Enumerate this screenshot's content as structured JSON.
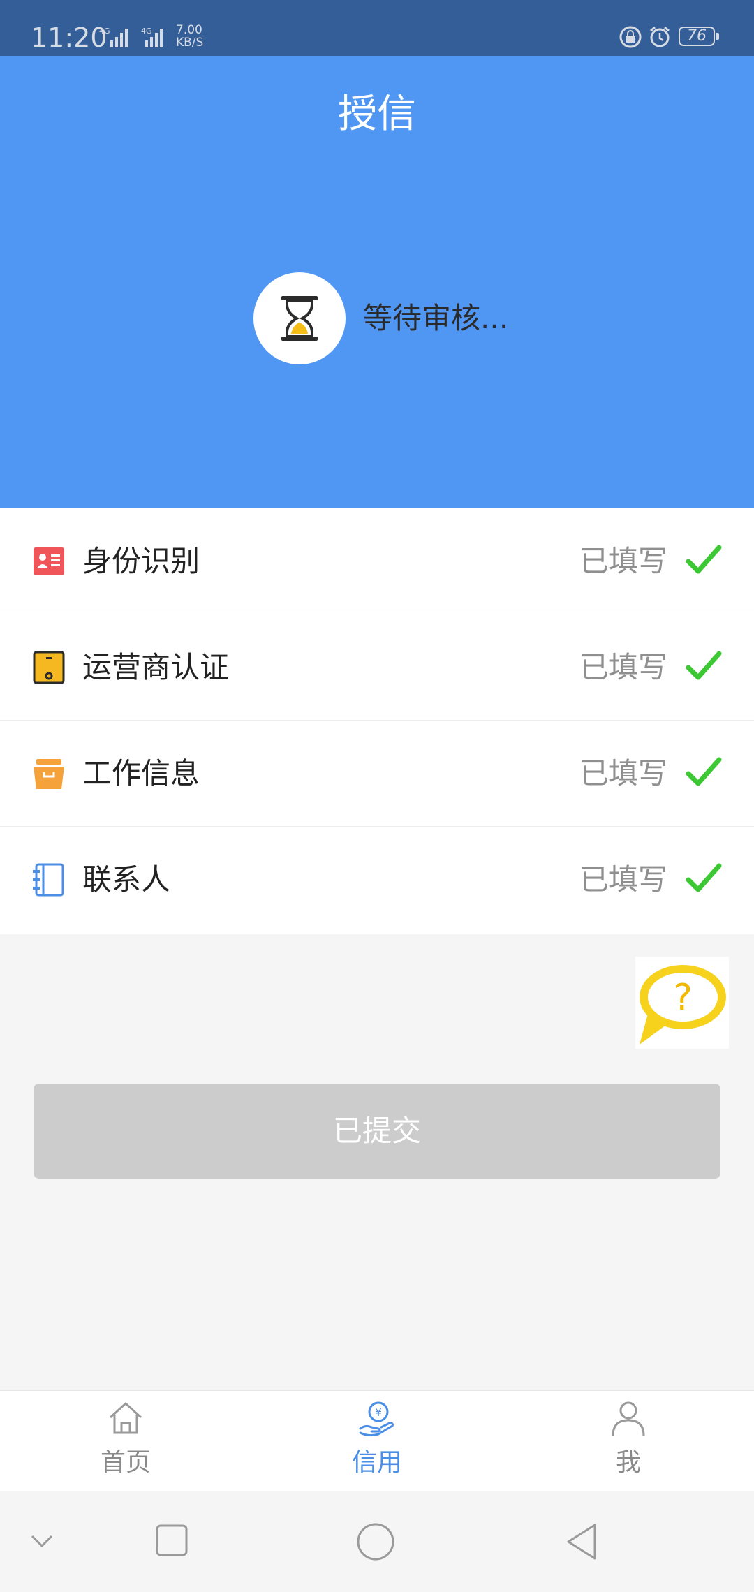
{
  "status_bar": {
    "time": "11:20",
    "network_speed": "7.00",
    "network_speed_unit": "KB/S",
    "battery": "76",
    "signal_1": "4G",
    "signal_2": "4G"
  },
  "header": {
    "title": "授信",
    "review_status": "等待审核...",
    "background_color": "#5096f3"
  },
  "steps": [
    {
      "label": "身份识别",
      "status": "已填写",
      "icon": "id-card-icon",
      "icon_color": "#f0555a"
    },
    {
      "label": "运营商认证",
      "status": "已填写",
      "icon": "phone-icon",
      "icon_color": "#f5b820"
    },
    {
      "label": "工作信息",
      "status": "已填写",
      "icon": "briefcase-icon",
      "icon_color": "#f5a23a"
    },
    {
      "label": "联系人",
      "status": "已填写",
      "icon": "contacts-book-icon",
      "icon_color": "#4a8ee6"
    }
  ],
  "submit_button": {
    "label": "已提交",
    "enabled": false
  },
  "tabs": [
    {
      "label": "首页",
      "icon": "home-icon",
      "active": false
    },
    {
      "label": "信用",
      "icon": "credit-hand-icon",
      "active": true
    },
    {
      "label": "我",
      "icon": "profile-icon",
      "active": false
    }
  ],
  "colors": {
    "check": "#3cc832",
    "active_tab": "#4a8ee6",
    "status_bar": "#345e97"
  }
}
